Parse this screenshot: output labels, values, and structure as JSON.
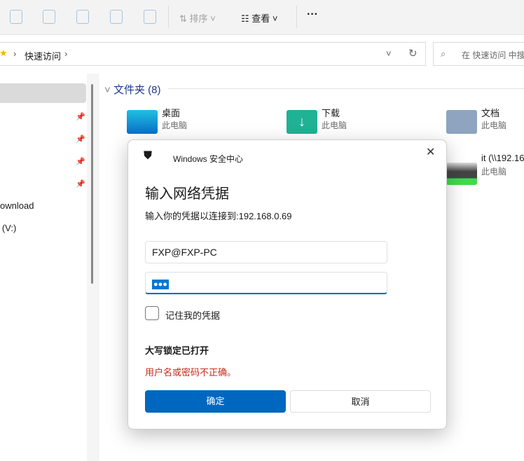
{
  "toolbar": {
    "sort_label": "排序",
    "view_label": "查看",
    "more_label": "···"
  },
  "address": {
    "crumb": "快速访问",
    "search_placeholder": "在 快速访问 中搜"
  },
  "sidebar": {
    "items": [
      "ownload",
      "a (V:)"
    ]
  },
  "section": {
    "header": "文件夹 (8)"
  },
  "folders": [
    {
      "name": "桌面",
      "sub": "此电脑"
    },
    {
      "name": "下载",
      "sub": "此电脑"
    },
    {
      "name": "文档",
      "sub": "此电脑"
    },
    {
      "name": "it (\\\\192.16",
      "sub": "此电脑"
    }
  ],
  "dialog": {
    "app_title": "Windows 安全中心",
    "heading": "输入网络凭据",
    "subtitle": "输入你的凭据以连接到:192.168.0.69",
    "username": "FXP@FXP-PC",
    "password": "●●●",
    "remember_label": "记住我的凭据",
    "capslock": "大写锁定已打开",
    "error": "用户名或密码不正确。",
    "ok": "确定",
    "cancel": "取消"
  },
  "colors": {
    "accent": "#0067c0",
    "error": "#c42b1c"
  }
}
